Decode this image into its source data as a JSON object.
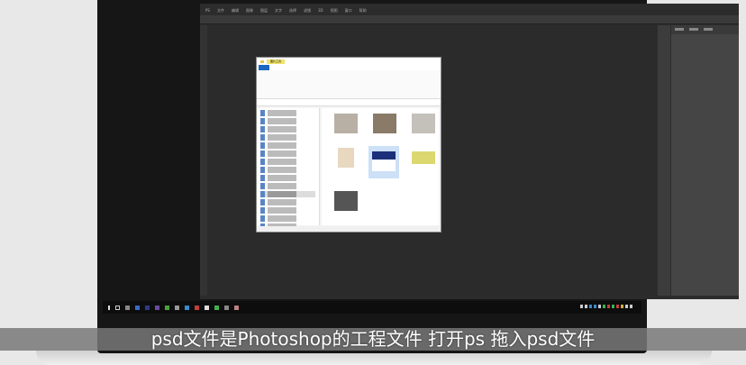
{
  "photoshop": {
    "menu_items": [
      "PS",
      "文件",
      "编辑",
      "图像",
      "图层",
      "文字",
      "选择",
      "滤镜",
      "3D",
      "视图",
      "窗口",
      "帮助"
    ]
  },
  "explorer": {
    "ribbon_tab_active": "图片工具"
  },
  "subtitle": "psd文件是Photoshop的工程文件 打开ps 拖入psd文件",
  "colors": {
    "background": "#e8e8e8",
    "ps_canvas": "#2b2b2b",
    "subtitle_band": "#787878",
    "explorer_accent": "#1a66c2"
  }
}
